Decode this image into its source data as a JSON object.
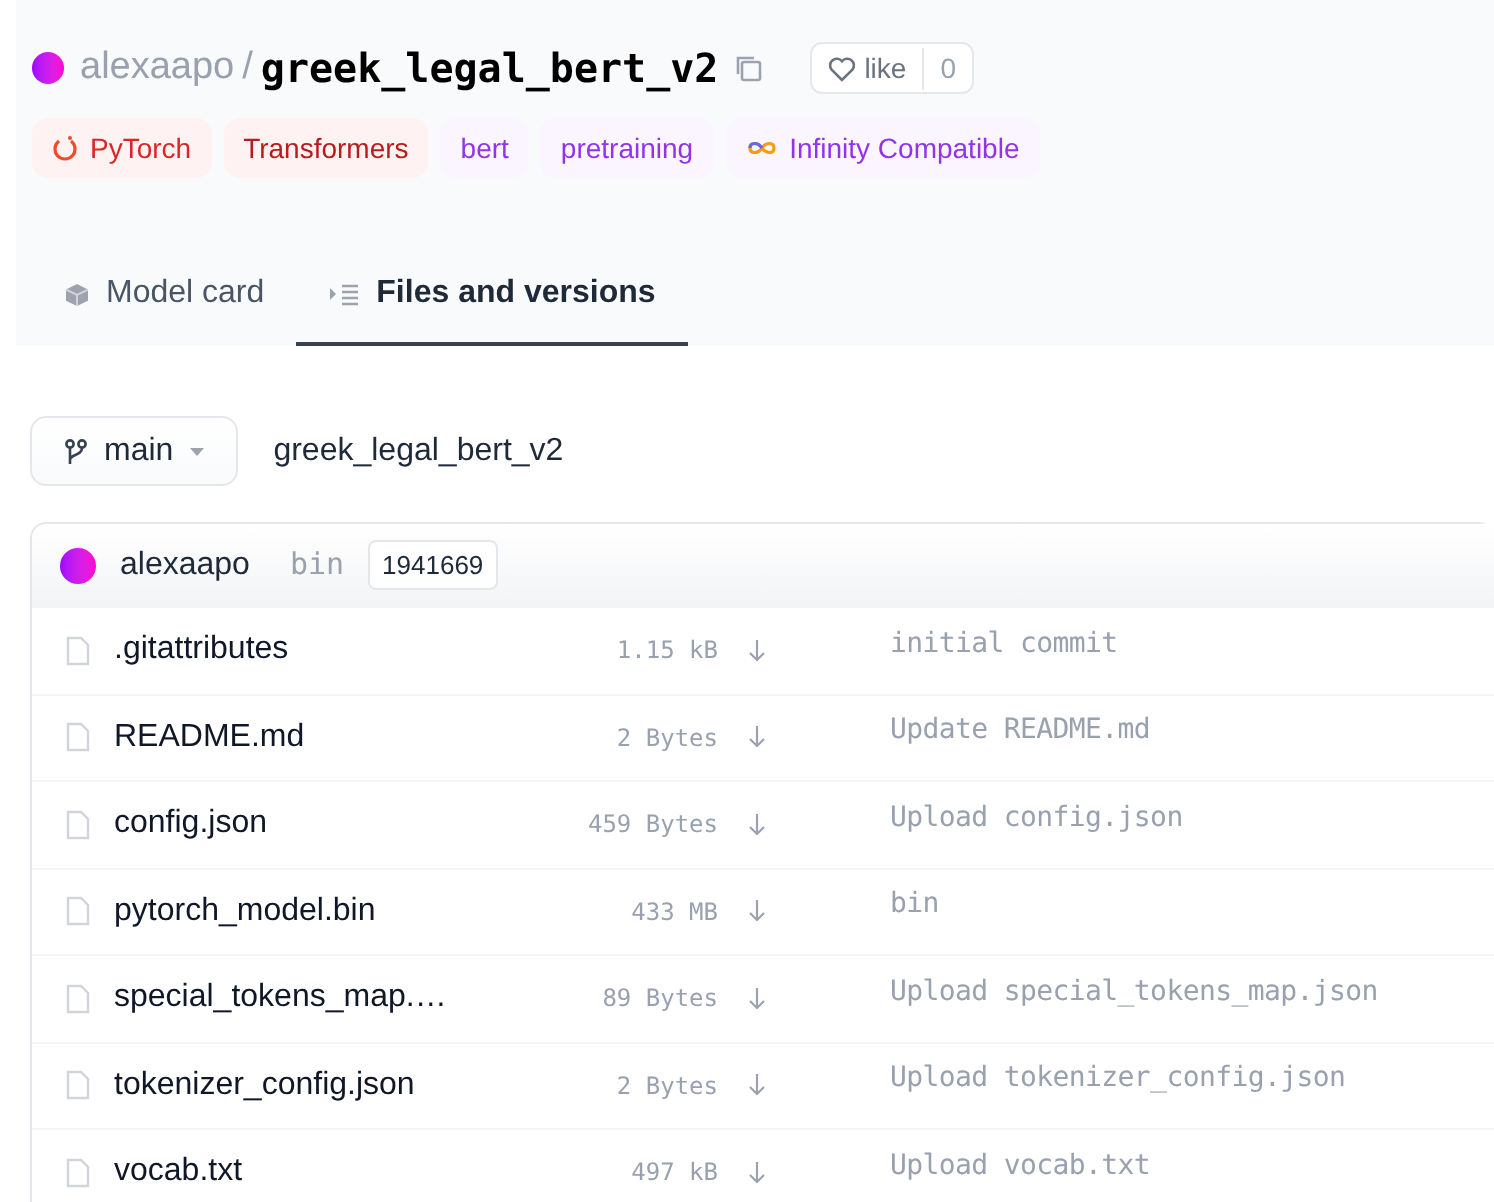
{
  "header": {
    "owner": "alexaapo",
    "separator": "/",
    "repo": "greek_legal_bert_v2",
    "like": {
      "label": "like",
      "count": "0"
    }
  },
  "tags": [
    {
      "label": "PyTorch",
      "kind": "framework"
    },
    {
      "label": "Transformers",
      "kind": "library"
    },
    {
      "label": "bert",
      "kind": "other"
    },
    {
      "label": "pretraining",
      "kind": "other"
    },
    {
      "label": "Infinity Compatible",
      "kind": "infinity"
    }
  ],
  "tabs": [
    {
      "label": "Model card",
      "kind": "card",
      "selected": false
    },
    {
      "label": "Files and versions",
      "kind": "files",
      "selected": true
    }
  ],
  "branch": {
    "label": "main"
  },
  "path": "greek_legal_bert_v2",
  "commit": {
    "author": "alexaapo",
    "message": "bin",
    "hash": "1941669"
  },
  "files": [
    {
      "name": ".gitattributes",
      "size": "1.15 kB",
      "message": "initial commit"
    },
    {
      "name": "README.md",
      "size": "2 Bytes",
      "message": "Update README.md"
    },
    {
      "name": "config.json",
      "size": "459 Bytes",
      "message": "Upload config.json"
    },
    {
      "name": "pytorch_model.bin",
      "size": "433 MB",
      "message": "bin"
    },
    {
      "name": "special_tokens_map.…",
      "size": "89 Bytes",
      "message": "Upload special_tokens_map.json"
    },
    {
      "name": "tokenizer_config.json",
      "size": "2 Bytes",
      "message": "Upload tokenizer_config.json"
    },
    {
      "name": "vocab.txt",
      "size": "497 kB",
      "message": "Upload vocab.txt"
    }
  ]
}
